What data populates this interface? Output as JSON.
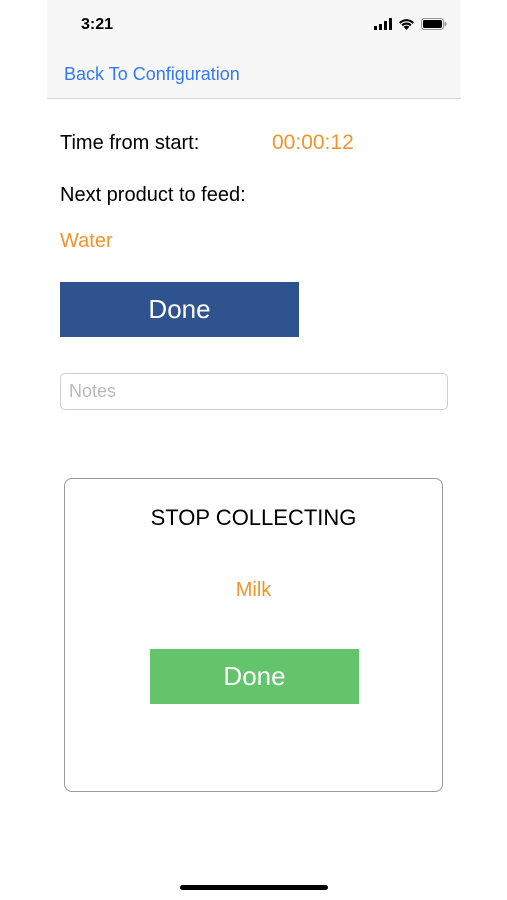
{
  "status_bar": {
    "time": "3:21",
    "icons": [
      "cellular-signal-icon",
      "wifi-icon",
      "battery-icon"
    ]
  },
  "navbar": {
    "back_label": "Back To Configuration"
  },
  "session": {
    "time_label": "Time from start:",
    "time_value": "00:00:12",
    "next_label": "Next product to feed:",
    "next_product": "Water",
    "done_label": "Done"
  },
  "notes": {
    "placeholder": "Notes",
    "value": ""
  },
  "stop_card": {
    "title": "STOP COLLECTING",
    "product": "Milk",
    "done_label": "Done"
  },
  "colors": {
    "accent_link": "#3478f6",
    "accent_orange": "#f0952b",
    "primary_button": "#2e538f",
    "success_button": "#63c46c"
  }
}
